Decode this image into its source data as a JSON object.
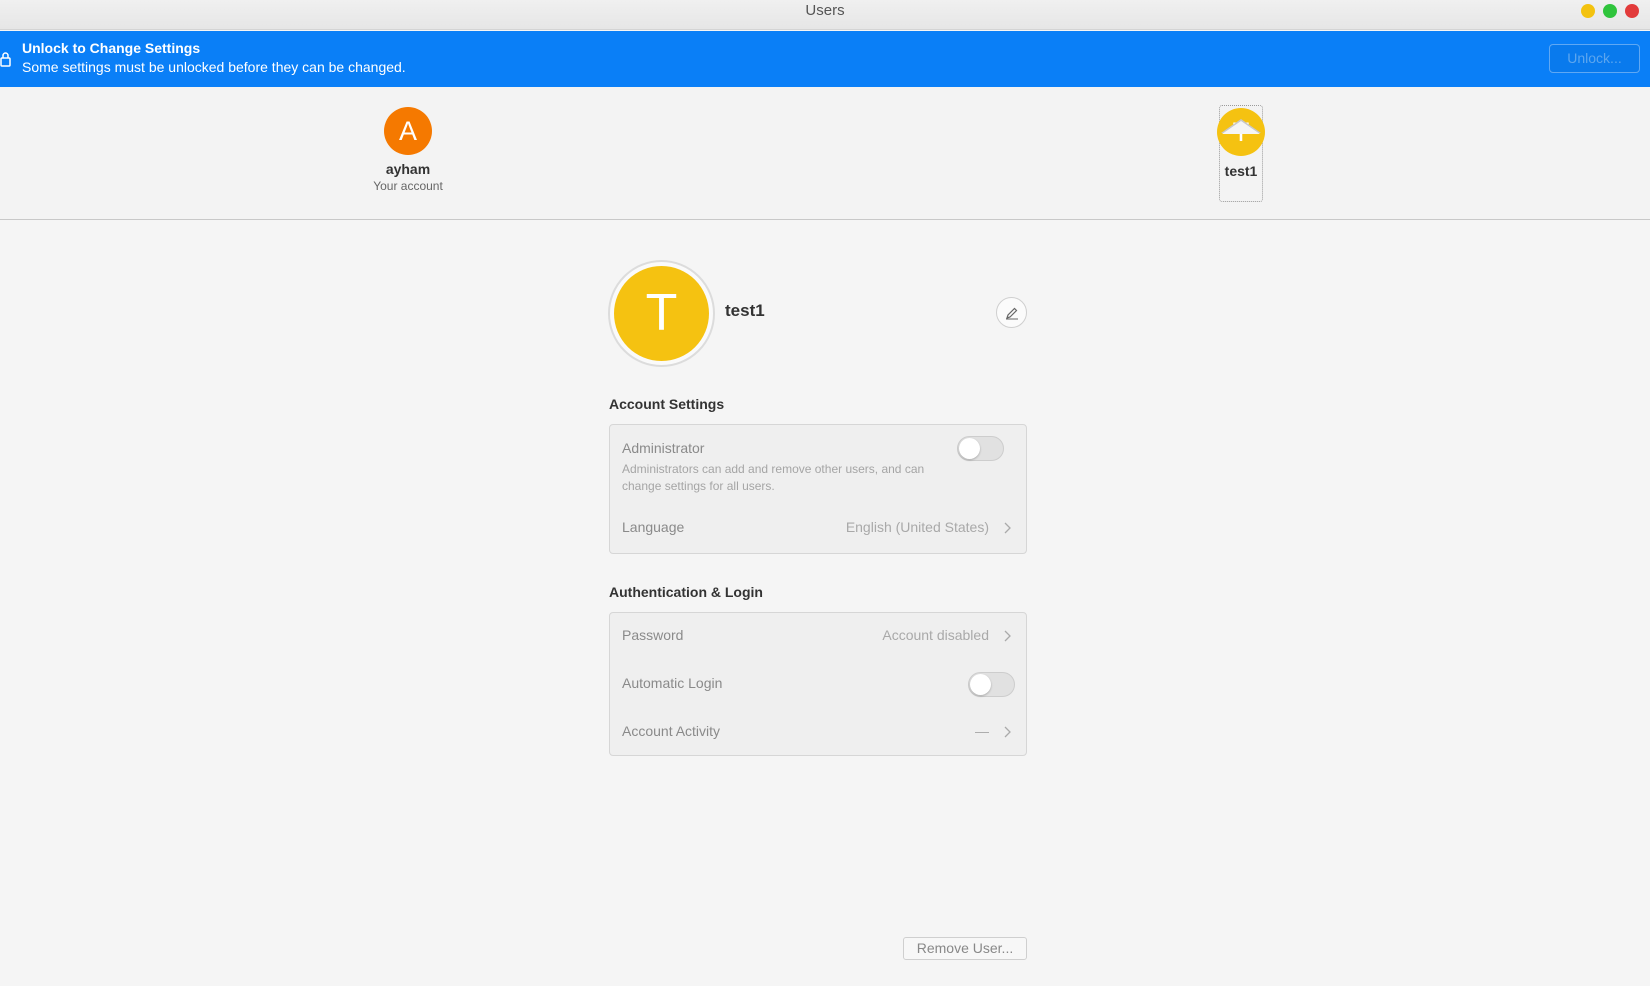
{
  "window": {
    "title": "Users",
    "controls": {
      "minimize": "minimize",
      "maximize": "maximize",
      "close": "close"
    }
  },
  "infobar": {
    "title": "Unlock to Change Settings",
    "subtitle": "Some settings must be unlocked before they can be changed.",
    "unlock_label": "Unlock...",
    "icon": "lock-icon",
    "color": "#0a7ff7"
  },
  "users": [
    {
      "initial": "A",
      "name": "ayham",
      "subtitle": "Your account",
      "color": "#f57900"
    },
    {
      "initial": "T",
      "name": "test1",
      "subtitle": "",
      "color": "#f5c211",
      "selected": true
    }
  ],
  "detail": {
    "initial": "T",
    "name": "test1",
    "avatar_color": "#f5c211",
    "edit_icon": "pencil-icon"
  },
  "account_settings": {
    "title": "Account Settings",
    "administrator": {
      "label": "Administrator",
      "description": "Administrators can add and remove other users, and can change settings for all users.",
      "enabled": false
    },
    "language": {
      "label": "Language",
      "value": "English (United States)"
    }
  },
  "authentication": {
    "title": "Authentication & Login",
    "password": {
      "label": "Password",
      "value": "Account disabled"
    },
    "automatic_login": {
      "label": "Automatic Login",
      "enabled": false
    },
    "account_activity": {
      "label": "Account Activity",
      "value": "—"
    }
  },
  "remove_user_label": "Remove User..."
}
